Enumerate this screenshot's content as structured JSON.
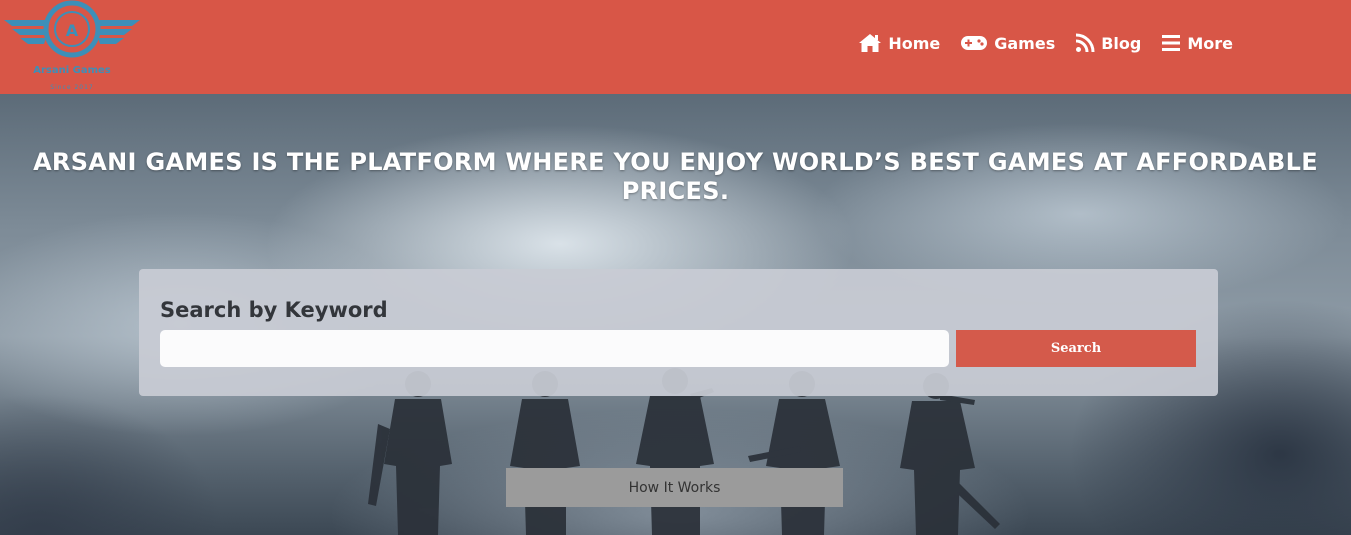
{
  "header": {
    "logo": {
      "name": "Arsani Games",
      "tagline": "Since 2017",
      "letter": "A"
    },
    "nav": [
      {
        "label": "Home",
        "icon": "home-icon"
      },
      {
        "label": "Games",
        "icon": "gamepad-icon"
      },
      {
        "label": "Blog",
        "icon": "rss-icon"
      },
      {
        "label": "More",
        "icon": "menu-icon"
      }
    ]
  },
  "hero": {
    "headline": "ARSANI GAMES IS THE PLATFORM WHERE YOU ENJOY WORLD’S BEST GAMES AT AFFORDABLE PRICES.",
    "search": {
      "heading": "Search by Keyword",
      "input_value": "",
      "placeholder": "",
      "button_label": "Search"
    },
    "how_it_works_label": "How It Works"
  },
  "colors": {
    "header_bg": "#d85647",
    "search_button": "#d45a4b",
    "logo_blue": "#3d8fb8",
    "how_button": "#9b9b9b"
  }
}
